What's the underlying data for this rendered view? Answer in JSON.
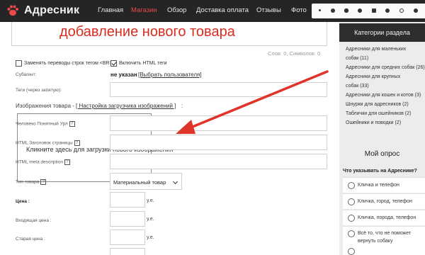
{
  "header": {
    "logo_text": "Адресник",
    "nav": [
      "Главная",
      "Магазин",
      "Обзор",
      "Доставка оплата",
      "Отзывы",
      "Фото"
    ],
    "active_nav": "Магазин",
    "accent": "#e84a4a"
  },
  "form": {
    "overlay_title": "добавление нового товара",
    "counts": "Слов: 0, Символов: 0",
    "replace_br_label": "Заменять переводы строк тегом <BR>",
    "enable_html_label": "Включить HTML теги",
    "subject_label": "Субагент:",
    "subject_value": "не указан",
    "subject_link": "[Выбрать пользователя]",
    "tags_label": "Теги (через запятую):",
    "images_label": "Изображения товара - ",
    "images_link": "[ Настройка загрузчика изображений ]",
    "images_suffix": " :",
    "url_label": "Человеко Понятный Урл",
    "html_title_label": "HTML Заголовок страницы",
    "meta_label": "HTML meta description",
    "upload_hint": "Кликните здесь для загрузки нового изображения",
    "type_label": "Тип товара",
    "type_value": "Материальный товар",
    "price_label": "Цена :",
    "incoming_price_label": "Входящая цена :",
    "old_price_label": "Старая цена :",
    "unit": "у.е.",
    "help_icon": "?"
  },
  "sidebar": {
    "categories_title": "Категории раздела",
    "categories": [
      "Адресники для маленьких",
      "собак (11)",
      "Адресники для средних собак (26)",
      "Адресники для крупных",
      "собак (33)",
      "Адресники для кошек и котов (3)",
      "Шнурки для адресников (2)",
      "Таблички для ошейников (2)",
      "Ошейники и поводки (2)"
    ],
    "poll_title": "Мой опрос",
    "poll_question": "Что указывать на Адреснике?",
    "poll_options": [
      "Кличка и телефон",
      "Кличка, город, телефон",
      "Кличка, порода, телефон",
      "Всё то, что не поможет",
      "вернуть собаку"
    ]
  }
}
